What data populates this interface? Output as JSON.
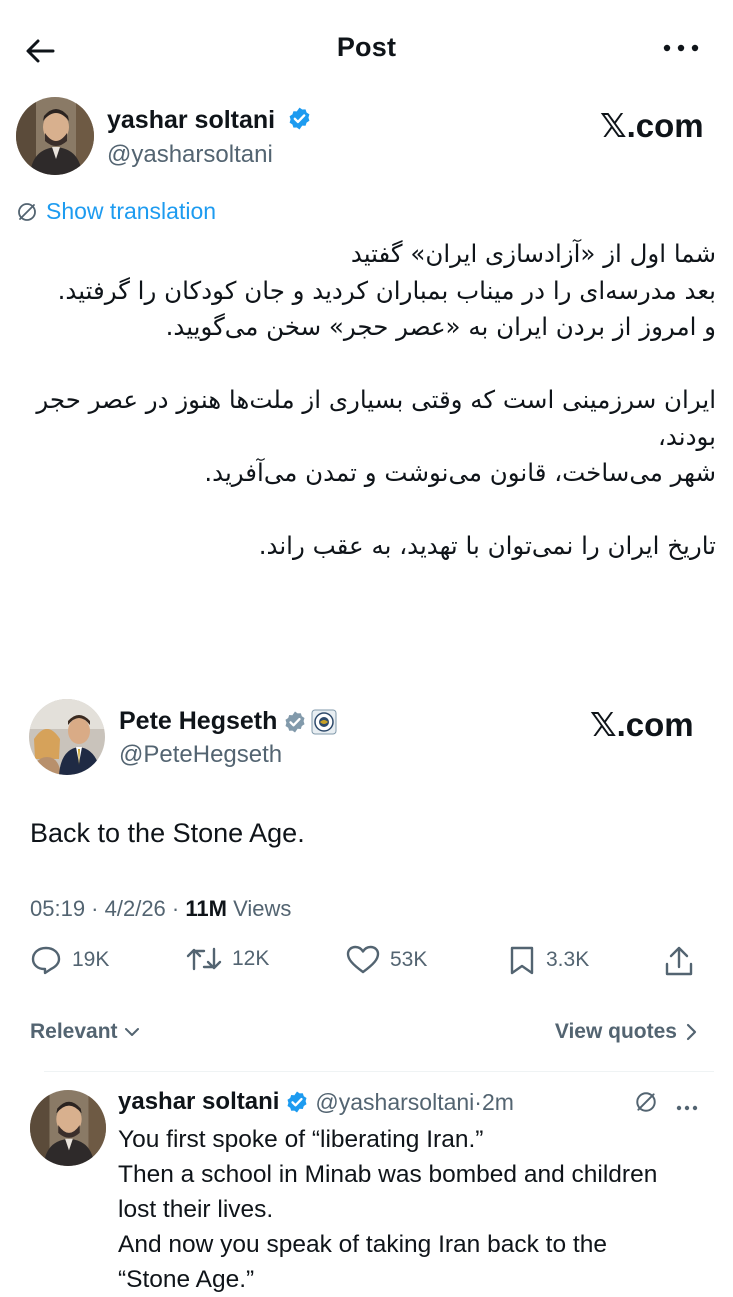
{
  "header": {
    "title": "Post",
    "back_icon": "arrow-left-icon",
    "more_icon": "more-horizontal-icon"
  },
  "quoting_author": {
    "name": "yashar soltani",
    "handle": "@yasharsoltani",
    "verified": true,
    "watermark": "𝕏.com"
  },
  "translation": {
    "label": "Show translation"
  },
  "farsi_body": {
    "line1": "شما اول از «آزادسازی ایران» گفتید",
    "line2": "بعد مدرسه‌ای را در میناب بمباران کردید و جان کودکان را گرفتید.",
    "line3": "و امروز از بردن ایران به «عصر حجر» سخن می‌گویید.",
    "line4": "ایران سرزمینی است که وقتی بسیاری از ملت‌ها هنوز در عصر حجر بودند،",
    "line5": "شهر می‌ساخت، قانون می‌نوشت و تمدن می‌آفرید.",
    "line6": "تاریخ ایران را نمی‌توان با تهدید، به عقب راند."
  },
  "quoted_author": {
    "name": "Pete Hegseth",
    "handle": "@PeteHegseth",
    "verified": true,
    "watermark": "𝕏.com"
  },
  "quoted_text": "Back to the Stone Age.",
  "meta": {
    "time": "05:19",
    "sep1": " · ",
    "date": "4/2/26",
    "sep2": " · ",
    "views_count": "11M",
    "views_label": " Views"
  },
  "actions": {
    "replies": "19K",
    "reposts": "12K",
    "likes": "53K",
    "bookmarks": "3.3K"
  },
  "sort": {
    "label": "Relevant",
    "view_quotes": "View quotes"
  },
  "reply": {
    "name": "yashar soltani",
    "handle": "@yasharsoltani",
    "sep": " · ",
    "time": "2m",
    "line1": "You first spoke of “liberating Iran.”",
    "line2": "Then a school in Minab was bombed and children",
    "line3": "lost their lives.",
    "line4": "And now you speak of taking Iran back to the",
    "line5": "“Stone Age.”"
  },
  "colors": {
    "accent": "#1d9bf0",
    "secondary_text": "#536471",
    "primary_text": "#0f1419",
    "verified_gold": "#829aab"
  }
}
